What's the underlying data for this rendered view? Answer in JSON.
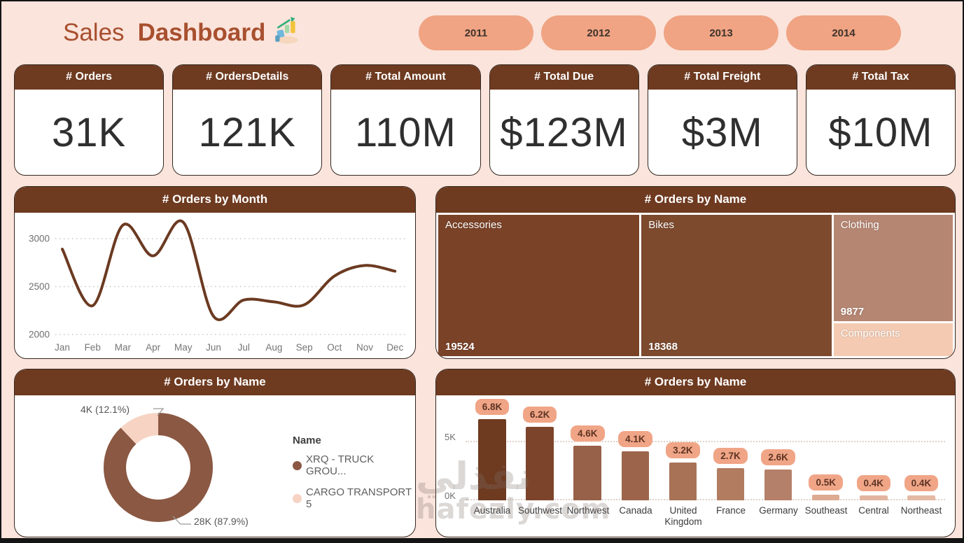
{
  "header": {
    "title_light": "Sales",
    "title_bold": "Dashboard",
    "icon": "hand-holding-growth-chart-icon",
    "years": [
      "2011",
      "2012",
      "2013",
      "2014"
    ]
  },
  "kpis": [
    {
      "label": "# Orders",
      "value": "31K"
    },
    {
      "label": "# OrdersDetails",
      "value": "121K"
    },
    {
      "label": "# Total Amount",
      "value": "110M"
    },
    {
      "label": "# Total Due",
      "value": "$123M"
    },
    {
      "label": "# Total Freight",
      "value": "$3M"
    },
    {
      "label": "# Total Tax",
      "value": "$10M"
    }
  ],
  "colors": {
    "page_bg": "#fbe4dc",
    "panel_header": "#6e3a20",
    "pill_bg": "#f0a483",
    "line": "#6b3a21",
    "title_text": "#a8502f"
  },
  "chart_data": [
    {
      "type": "line",
      "title": "# Orders by Month",
      "x": [
        "Jan",
        "Feb",
        "Mar",
        "Apr",
        "May",
        "Jun",
        "Jul",
        "Aug",
        "Sep",
        "Oct",
        "Nov",
        "Dec"
      ],
      "values": [
        2890,
        2300,
        3140,
        2820,
        3170,
        2190,
        2360,
        2340,
        2310,
        2610,
        2720,
        2660
      ],
      "yticks": [
        3000,
        2500,
        2000
      ],
      "ylim": [
        2000,
        3250
      ],
      "grid": true,
      "legend_position": "none",
      "line_color": "#6b3a21"
    },
    {
      "type": "treemap",
      "title": "# Orders by Name",
      "items": [
        {
          "name": "Accessories",
          "value": 19524,
          "value_label": "19524",
          "color": "#7a4227"
        },
        {
          "name": "Bikes",
          "value": 18368,
          "value_label": "18368",
          "color": "#7d4a2e"
        },
        {
          "name": "Clothing",
          "value": 9877,
          "value_label": "9877",
          "color": "#b58672"
        },
        {
          "name": "Components",
          "value_label": "",
          "size_hint": 2560,
          "color": "#f4cbb2"
        }
      ],
      "layout": "two-columns-then-stacked-column"
    },
    {
      "type": "donut",
      "title": "# Orders by Name",
      "legend_title": "Name",
      "legend_position": "right",
      "slices": [
        {
          "name": "XRQ - TRUCK GROU...",
          "pct": 87.9,
          "callout": "28K (87.9%)",
          "color": "#8a5843"
        },
        {
          "name": "CARGO TRANSPORT 5",
          "pct": 12.1,
          "callout": "4K (12.1%)",
          "color": "#f7d3c3"
        }
      ]
    },
    {
      "type": "bar",
      "title": "# Orders by Name",
      "categories": [
        "Australia",
        "Southwest",
        "Northwest",
        "Canada",
        "United Kingdom",
        "France",
        "Germany",
        "Southeast",
        "Central",
        "Northeast"
      ],
      "values": [
        6.8,
        6.2,
        4.6,
        4.1,
        3.2,
        2.7,
        2.6,
        0.5,
        0.4,
        0.4
      ],
      "unit": "K",
      "labels": [
        "6.8K",
        "6.2K",
        "4.6K",
        "4.1K",
        "3.2K",
        "2.7K",
        "2.6K",
        "0.5K",
        "0.4K",
        "0.4K"
      ],
      "yticks": [
        "5K",
        "0K"
      ],
      "ylim": [
        0,
        7.3
      ],
      "grid": true,
      "bar_colors": [
        "#6e3a20",
        "#7c442a",
        "#976149",
        "#9c654b",
        "#a87257",
        "#b17c60",
        "#b5806a",
        "#dcab92",
        "#e2b5a0",
        "#e4b9a4"
      ],
      "label_pill_bg": "#f0a587"
    }
  ],
  "watermark": {
    "arabic": "نفذلي",
    "latin": "hafezly.com"
  }
}
